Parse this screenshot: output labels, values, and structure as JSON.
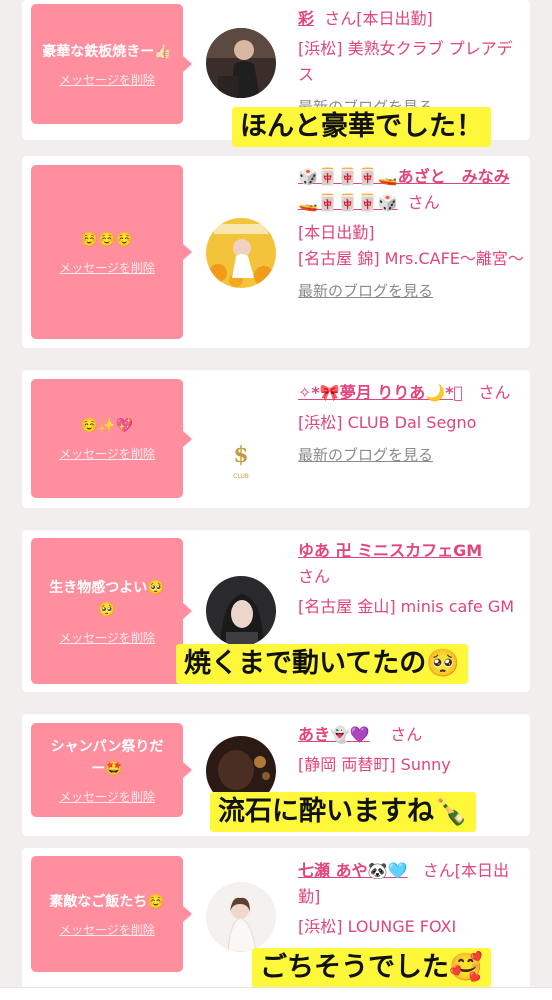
{
  "items": [
    {
      "message": "豪華な鉄板焼きー👍🏻",
      "delete_label": "メッセージを削除",
      "name": "彩",
      "san": "さん",
      "status": "[本日出勤]",
      "shop": "[浜松] 美熟女クラブ プレアデス",
      "blog": "最新のブログを見る",
      "caption": "ほんと豪華でした！"
    },
    {
      "message": "☺️☺️☺️",
      "delete_label": "メッセージを削除",
      "name": "🎲🀄🀄🀄🚤あざと　みなみ🚤🀄🀄🀄🎲",
      "san": "さん",
      "status": "[本日出勤]",
      "shop": "[名古屋 錦] Mrs.CAFE〜離宮〜",
      "blog": "最新のブログを見る"
    },
    {
      "message": "☺️✨💖",
      "delete_label": "メッセージを削除",
      "name": "✧*🎀夢月 りりあ🌙*ﾟ",
      "san": "さん",
      "shop": "[浜松] CLUB Dal Segno",
      "blog": "最新のブログを見る"
    },
    {
      "message": "生き物感つよい🥺🥺",
      "delete_label": "メッセージを削除",
      "name": "ゆあ 卍 ミニスカフェGM",
      "san": "さん",
      "shop": "[名古屋 金山] minis cafe GM",
      "caption": "焼くまで動いてたの🥺"
    },
    {
      "message": "シャンパン祭りだー🤩",
      "delete_label": "メッセージを削除",
      "name": "あき👻💜",
      "san": "さん",
      "shop": "[静岡 両替町] Sunny",
      "caption": "流石に酔いますね🍾"
    },
    {
      "message": "素敵なご飯たち☺️",
      "delete_label": "メッセージを削除",
      "name": "七瀬 あや🐼🩵",
      "san": "さん",
      "status": "[本日出勤]",
      "shop": "[浜松] LOUNGE FOXI",
      "caption": "ごちそうでした🥰"
    }
  ]
}
